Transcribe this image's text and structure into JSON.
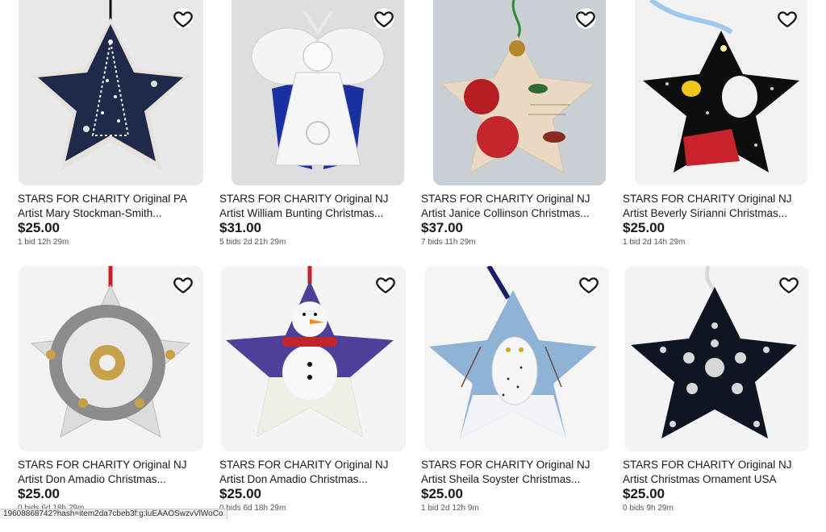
{
  "listings": [
    {
      "title": "STARS FOR CHARITY Original PA Artist Mary Stockman-Smith...",
      "price": "$25.00",
      "meta": "1 bid 12h 29m",
      "image": "star-ornament-navy-silver-tree",
      "colors": {
        "bg": "#e9e9ec",
        "star": "#1f2a4a",
        "accent": "#e8e2dc"
      }
    },
    {
      "title": "STARS FOR CHARITY Original NJ Artist William Bunting Christmas...",
      "price": "$31.00",
      "meta": "5 bids 2d 21h 29m",
      "image": "white-lace-angel-ornament",
      "colors": {
        "bg": "#dedee0",
        "star": "#1a2fa0",
        "accent": "#f4f4f4"
      }
    },
    {
      "title": "STARS FOR CHARITY Original NJ Artist Janice Collinson Christmas...",
      "price": "$37.00",
      "meta": "7 bids 11h 29m",
      "image": "poinsettia-decoupage-star",
      "colors": {
        "bg": "#c9cfd4",
        "star": "#ead9c2",
        "accent": "#b51f24"
      }
    },
    {
      "title": "STARS FOR CHARITY Original NJ Artist Beverly Sirianni Christmas...",
      "price": "$25.00",
      "meta": "1 bid 2d 14h 29m",
      "image": "snoopy-doghouse-black-star",
      "colors": {
        "bg": "#f2f2f2",
        "star": "#0d0d0d",
        "accent": "#c8232b"
      }
    },
    {
      "title": "STARS FOR CHARITY Original NJ Artist Don Amadio Christmas...",
      "price": "$25.00",
      "meta": "0 bids 6d 18h 29m",
      "image": "bike-gear-steampunk-star",
      "colors": {
        "bg": "#f3f3f3",
        "star": "#9c9c9c",
        "accent": "#c8a24a"
      }
    },
    {
      "title": "STARS FOR CHARITY Original NJ Artist Don Amadio Christmas...",
      "price": "$25.00",
      "meta": "0 bids 6d 18h 29m",
      "image": "snowman-purple-star",
      "colors": {
        "bg": "#f4f4f4",
        "star": "#4e3f9a",
        "accent": "#c1262a"
      }
    },
    {
      "title": "STARS FOR CHARITY Original NJ Artist Sheila Soyster Christmas...",
      "price": "$25.00",
      "meta": "1 bid 2d 12h 9m",
      "image": "snowy-owl-winter-star",
      "colors": {
        "bg": "#f5f5f5",
        "star": "#8fb3d6",
        "accent": "#f6f6f6"
      }
    },
    {
      "title": "STARS FOR CHARITY Original NJ Artist Christmas Ornament USA",
      "price": "$25.00",
      "meta": "0 bids 9h 29m",
      "image": "black-rhinestone-star",
      "colors": {
        "bg": "#f4f4f4",
        "star": "#0f1422",
        "accent": "#d8d8d8"
      }
    }
  ],
  "watch_icon": "heart-icon",
  "status_url": "19608868742?hash=item2da7cbeb3f:g:luEAAOSwzvVlWoCo"
}
